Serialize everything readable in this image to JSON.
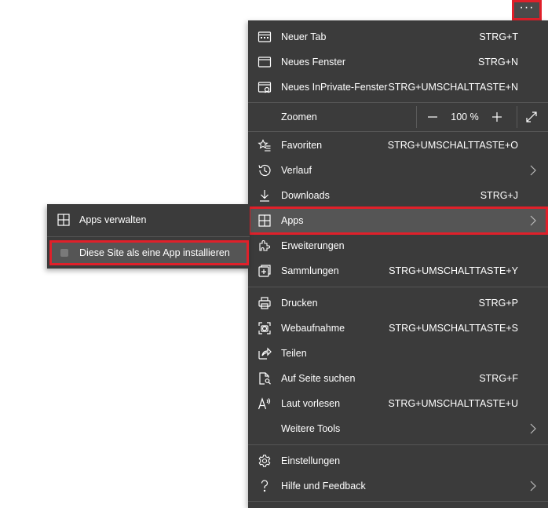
{
  "more_button": {
    "label": "···"
  },
  "menu": {
    "new_tab": {
      "label": "Neuer Tab",
      "shortcut": "STRG+T"
    },
    "new_window": {
      "label": "Neues Fenster",
      "shortcut": "STRG+N"
    },
    "new_private": {
      "label": "Neues InPrivate-Fenster",
      "shortcut": "STRG+UMSCHALTTASTE+N"
    },
    "zoom": {
      "label": "Zoomen",
      "value": "100 %",
      "minus": "−",
      "plus": "+"
    },
    "favorites": {
      "label": "Favoriten",
      "shortcut": "STRG+UMSCHALTTASTE+O"
    },
    "history": {
      "label": "Verlauf"
    },
    "downloads": {
      "label": "Downloads",
      "shortcut": "STRG+J"
    },
    "apps": {
      "label": "Apps"
    },
    "extensions": {
      "label": "Erweiterungen"
    },
    "collections": {
      "label": "Sammlungen",
      "shortcut": "STRG+UMSCHALTTASTE+Y"
    },
    "print": {
      "label": "Drucken",
      "shortcut": "STRG+P"
    },
    "web_capture": {
      "label": "Webaufnahme",
      "shortcut": "STRG+UMSCHALTTASTE+S"
    },
    "share": {
      "label": "Teilen"
    },
    "find": {
      "label": "Auf Seite suchen",
      "shortcut": "STRG+F"
    },
    "read_aloud": {
      "label": "Laut vorlesen",
      "shortcut": "STRG+UMSCHALTTASTE+U"
    },
    "more_tools": {
      "label": "Weitere Tools"
    },
    "settings": {
      "label": "Einstellungen"
    },
    "help": {
      "label": "Hilfe und Feedback"
    }
  },
  "apps_submenu": {
    "manage": {
      "label": "Apps verwalten"
    },
    "install": {
      "label": "Diese Site als eine App installieren"
    }
  },
  "colors": {
    "menu_bg": "#3b3b3b",
    "highlight_bg": "#555555",
    "highlight_border": "#e0202a",
    "text": "#ffffff"
  }
}
